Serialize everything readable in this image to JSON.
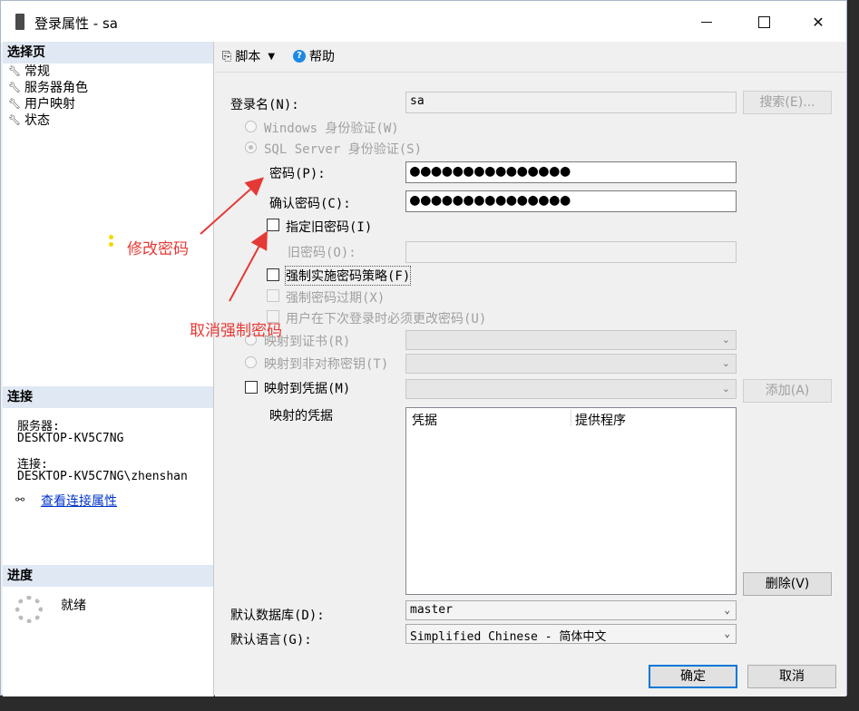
{
  "window": {
    "title": "登录属性 - sa"
  },
  "left": {
    "pages_header": "选择页",
    "pages": [
      {
        "label": "常规"
      },
      {
        "label": "服务器角色"
      },
      {
        "label": "用户映射"
      },
      {
        "label": "状态"
      }
    ],
    "connection_header": "连接",
    "server_label": "服务器:",
    "server_value": "DESKTOP-KV5C7NG",
    "connection_label": "连接:",
    "connection_value": "DESKTOP-KV5C7NG\\zhenshan",
    "view_link": "查看连接属性",
    "progress_header": "进度",
    "progress_status": "就绪"
  },
  "toolbar": {
    "script": "脚本",
    "help": "帮助"
  },
  "form": {
    "login_name_label": "登录名(N):",
    "login_name_value": "sa",
    "search_button": "搜索(E)...",
    "windows_auth": "Windows 身份验证(W)",
    "sql_auth": "SQL Server 身份验证(S)",
    "password_label": "密码(P):",
    "password_value": "●●●●●●●●●●●●●●●",
    "confirm_label": "确认密码(C):",
    "confirm_value": "●●●●●●●●●●●●●●●",
    "specify_old": "指定旧密码(I)",
    "old_password_label": "旧密码(O):",
    "enforce_policy": "强制实施密码策略(F)",
    "enforce_expiration": "强制密码过期(X)",
    "must_change": "用户在下次登录时必须更改密码(U)",
    "map_cert": "映射到证书(R)",
    "map_asym": "映射到非对称密钥(T)",
    "map_cred": "映射到凭据(M)",
    "add_button": "添加(A)",
    "mapped_creds_label": "映射的凭据",
    "grid_col_cred": "凭据",
    "grid_col_provider": "提供程序",
    "remove_button": "删除(V)",
    "default_db_label": "默认数据库(D):",
    "default_db_value": "master",
    "default_lang_label": "默认语言(G):",
    "default_lang_value": "Simplified Chinese - 简体中文",
    "ok_button": "确定",
    "cancel_button": "取消"
  },
  "annotations": {
    "modify_password": "修改密码",
    "cancel_enforce": "取消强制密码"
  },
  "colors": {
    "annotation": "#e53935",
    "primary_border": "#0078d7",
    "link": "#0033cc"
  }
}
